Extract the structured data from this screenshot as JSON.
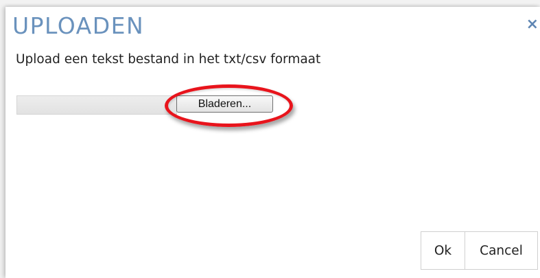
{
  "dialog": {
    "title": "UPLOADEN",
    "close_glyph": "×",
    "close_icon": "close-icon",
    "description": "Upload een tekst bestand in het txt/csv formaat",
    "file_input": {
      "value": "",
      "browse_label": "Bladeren..."
    },
    "highlight": {
      "color": "#e8141c",
      "target": "browse-button"
    },
    "buttons": {
      "ok_label": "Ok",
      "cancel_label": "Cancel"
    },
    "colors": {
      "title": "#6a92bd",
      "close": "#5f86b3"
    }
  }
}
